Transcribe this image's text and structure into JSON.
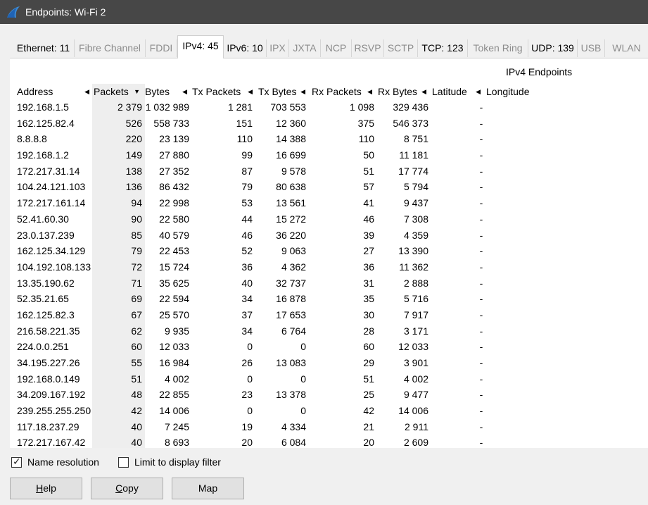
{
  "window": {
    "title": "Endpoints: Wi-Fi 2"
  },
  "tabs": [
    {
      "label": "Ethernet: 11",
      "state": "normal"
    },
    {
      "label": "Fibre Channel",
      "state": "disabled"
    },
    {
      "label": "FDDI",
      "state": "disabled"
    },
    {
      "label": "IPv4: 45",
      "state": "active"
    },
    {
      "label": "IPv6: 10",
      "state": "normal"
    },
    {
      "label": "IPX",
      "state": "disabled"
    },
    {
      "label": "JXTA",
      "state": "disabled"
    },
    {
      "label": "NCP",
      "state": "disabled"
    },
    {
      "label": "RSVP",
      "state": "disabled"
    },
    {
      "label": "SCTP",
      "state": "disabled"
    },
    {
      "label": "TCP: 123",
      "state": "normal"
    },
    {
      "label": "Token Ring",
      "state": "disabled"
    },
    {
      "label": "UDP: 139",
      "state": "normal"
    },
    {
      "label": "USB",
      "state": "disabled"
    },
    {
      "label": "WLAN",
      "state": "disabled"
    }
  ],
  "table": {
    "caption": "IPv4 Endpoints",
    "columns": [
      {
        "label": "Address",
        "sort": "left"
      },
      {
        "label": "Packets",
        "sort": "desc"
      },
      {
        "label": "Bytes",
        "sort": "left"
      },
      {
        "label": "Tx Packets",
        "sort": "left"
      },
      {
        "label": "Tx Bytes",
        "sort": "left"
      },
      {
        "label": "Rx Packets",
        "sort": "left"
      },
      {
        "label": "Rx Bytes",
        "sort": "left"
      },
      {
        "label": "Latitude",
        "sort": "left"
      },
      {
        "label": "Longitude",
        "sort": "none"
      }
    ],
    "rows": [
      [
        "192.168.1.5",
        "2 379",
        "1 032 989",
        "1 281",
        "703 553",
        "1 098",
        "329 436",
        "-"
      ],
      [
        "162.125.82.4",
        "526",
        "558 733",
        "151",
        "12 360",
        "375",
        "546 373",
        "-"
      ],
      [
        "8.8.8.8",
        "220",
        "23 139",
        "110",
        "14 388",
        "110",
        "8 751",
        "-"
      ],
      [
        "192.168.1.2",
        "149",
        "27 880",
        "99",
        "16 699",
        "50",
        "11 181",
        "-"
      ],
      [
        "172.217.31.14",
        "138",
        "27 352",
        "87",
        "9 578",
        "51",
        "17 774",
        "-"
      ],
      [
        "104.24.121.103",
        "136",
        "86 432",
        "79",
        "80 638",
        "57",
        "5 794",
        "-"
      ],
      [
        "172.217.161.14",
        "94",
        "22 998",
        "53",
        "13 561",
        "41",
        "9 437",
        "-"
      ],
      [
        "52.41.60.30",
        "90",
        "22 580",
        "44",
        "15 272",
        "46",
        "7 308",
        "-"
      ],
      [
        "23.0.137.239",
        "85",
        "40 579",
        "46",
        "36 220",
        "39",
        "4 359",
        "-"
      ],
      [
        "162.125.34.129",
        "79",
        "22 453",
        "52",
        "9 063",
        "27",
        "13 390",
        "-"
      ],
      [
        "104.192.108.133",
        "72",
        "15 724",
        "36",
        "4 362",
        "36",
        "11 362",
        "-"
      ],
      [
        "13.35.190.62",
        "71",
        "35 625",
        "40",
        "32 737",
        "31",
        "2 888",
        "-"
      ],
      [
        "52.35.21.65",
        "69",
        "22 594",
        "34",
        "16 878",
        "35",
        "5 716",
        "-"
      ],
      [
        "162.125.82.3",
        "67",
        "25 570",
        "37",
        "17 653",
        "30",
        "7 917",
        "-"
      ],
      [
        "216.58.221.35",
        "62",
        "9 935",
        "34",
        "6 764",
        "28",
        "3 171",
        "-"
      ],
      [
        "224.0.0.251",
        "60",
        "12 033",
        "0",
        "0",
        "60",
        "12 033",
        "-"
      ],
      [
        "34.195.227.26",
        "55",
        "16 984",
        "26",
        "13 083",
        "29",
        "3 901",
        "-"
      ],
      [
        "192.168.0.149",
        "51",
        "4 002",
        "0",
        "0",
        "51",
        "4 002",
        "-"
      ],
      [
        "34.209.167.192",
        "48",
        "22 855",
        "23",
        "13 378",
        "25",
        "9 477",
        "-"
      ],
      [
        "239.255.255.250",
        "42",
        "14 006",
        "0",
        "0",
        "42",
        "14 006",
        "-"
      ],
      [
        "117.18.237.29",
        "40",
        "7 245",
        "19",
        "4 334",
        "21",
        "2 911",
        "-"
      ],
      [
        "172.217.167.42",
        "40",
        "8 693",
        "20",
        "6 084",
        "20",
        "2 609",
        "-"
      ]
    ]
  },
  "options": {
    "name_resolution": {
      "label": "Name resolution",
      "checked": true
    },
    "limit_to_display_filter": {
      "label": "Limit to display filter",
      "checked": false
    }
  },
  "buttons": {
    "help": {
      "label_accel": "H",
      "label_rest": "elp"
    },
    "copy": {
      "label_accel": "C",
      "label_rest": "opy"
    },
    "map": {
      "label": "Map"
    }
  }
}
